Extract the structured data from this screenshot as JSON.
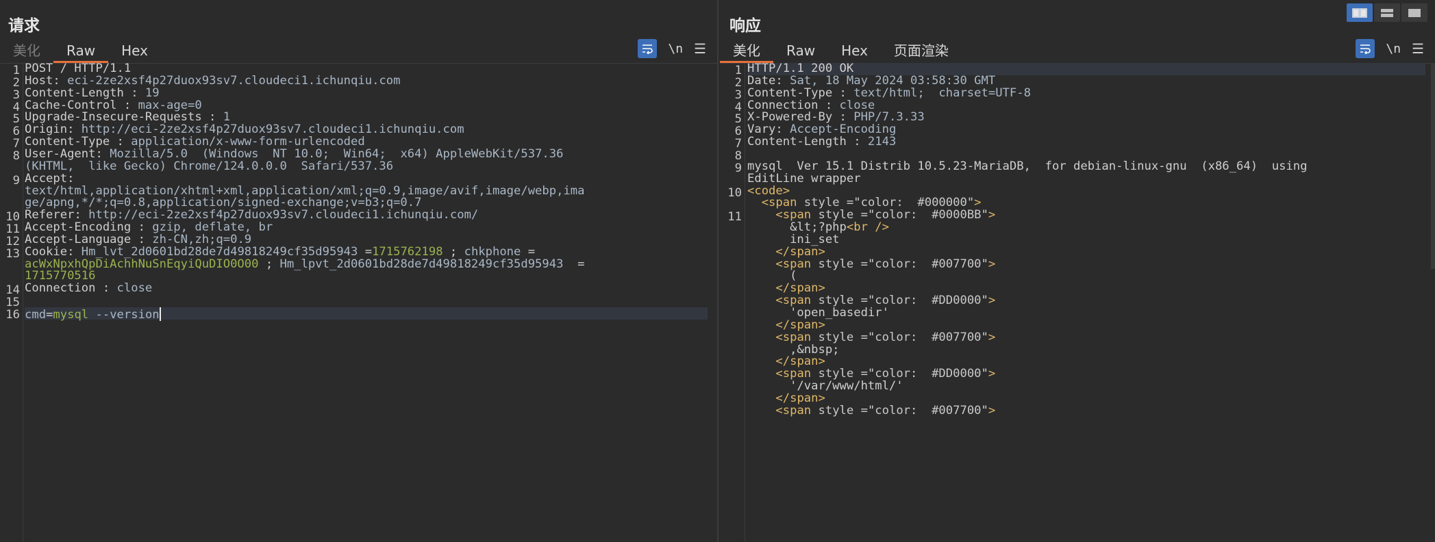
{
  "request": {
    "title": "请求",
    "tabs": [
      {
        "label": "美化",
        "state": "disabled"
      },
      {
        "label": "Raw",
        "state": "active"
      },
      {
        "label": "Hex",
        "state": "normal"
      }
    ],
    "newline_label": "\\n",
    "lines": [
      {
        "n": "1",
        "segs": [
          {
            "t": "POST / HTTP/1.1",
            "c": "k"
          }
        ]
      },
      {
        "n": "2",
        "segs": [
          {
            "t": "Host",
            "c": "k"
          },
          {
            "t": ": ",
            "c": "k"
          },
          {
            "t": "eci-2ze2xsf4p27duox93sv7.cloudeci1.ichunqiu.com",
            "c": "v"
          }
        ]
      },
      {
        "n": "3",
        "segs": [
          {
            "t": "Content-Length",
            "c": "k"
          },
          {
            "t": " : ",
            "c": "k"
          },
          {
            "t": "19",
            "c": "v"
          }
        ]
      },
      {
        "n": "4",
        "segs": [
          {
            "t": "Cache-Control",
            "c": "k"
          },
          {
            "t": " : ",
            "c": "k"
          },
          {
            "t": "max-age=0",
            "c": "v"
          }
        ]
      },
      {
        "n": "5",
        "segs": [
          {
            "t": "Upgrade-Insecure-Requests",
            "c": "k"
          },
          {
            "t": " : ",
            "c": "k"
          },
          {
            "t": "1",
            "c": "v"
          }
        ]
      },
      {
        "n": "6",
        "segs": [
          {
            "t": "Origin",
            "c": "k"
          },
          {
            "t": ": ",
            "c": "k"
          },
          {
            "t": "http://eci-2ze2xsf4p27duox93sv7.cloudeci1.ichunqiu.com",
            "c": "v"
          }
        ]
      },
      {
        "n": "7",
        "segs": [
          {
            "t": "Content-Type",
            "c": "k"
          },
          {
            "t": " : ",
            "c": "k"
          },
          {
            "t": "application/x-www-form-urlencoded",
            "c": "v"
          }
        ]
      },
      {
        "n": "8",
        "segs": [
          {
            "t": "User-Agent",
            "c": "k"
          },
          {
            "t": ": ",
            "c": "k"
          },
          {
            "t": "Mozilla/5.0  (Windows  NT 10.0;  Win64;  x64) AppleWebKit/537.36",
            "c": "v"
          }
        ]
      },
      {
        "n": "",
        "segs": [
          {
            "t": "(KHTML,  like Gecko) Chrome/124.0.0.0  Safari/537.36",
            "c": "v"
          }
        ]
      },
      {
        "n": "9",
        "segs": [
          {
            "t": "Accept",
            "c": "k"
          },
          {
            "t": ":",
            "c": "k"
          }
        ]
      },
      {
        "n": "",
        "segs": [
          {
            "t": "text/html,application/xhtml+xml,application/xml;q=0.9,image/avif,image/webp,ima",
            "c": "v"
          }
        ]
      },
      {
        "n": "",
        "segs": [
          {
            "t": "ge/apng,*/*;q=0.8,application/signed-exchange;v=b3;q=0.7",
            "c": "v"
          }
        ]
      },
      {
        "n": "10",
        "segs": [
          {
            "t": "Referer",
            "c": "k"
          },
          {
            "t": ": ",
            "c": "k"
          },
          {
            "t": "http://eci-2ze2xsf4p27duox93sv7.cloudeci1.ichunqiu.com/",
            "c": "v"
          }
        ]
      },
      {
        "n": "11",
        "segs": [
          {
            "t": "Accept-Encoding",
            "c": "k"
          },
          {
            "t": " : ",
            "c": "k"
          },
          {
            "t": "gzip, deflate, br",
            "c": "v"
          }
        ]
      },
      {
        "n": "12",
        "segs": [
          {
            "t": "Accept-Language",
            "c": "k"
          },
          {
            "t": " : ",
            "c": "k"
          },
          {
            "t": "zh-CN,zh;q=0.9",
            "c": "v"
          }
        ]
      },
      {
        "n": "13",
        "segs": [
          {
            "t": "Cookie",
            "c": "k"
          },
          {
            "t": ": ",
            "c": "k"
          },
          {
            "t": "Hm_lvt_2d0601bd28de7d49818249cf35d95943",
            "c": "v"
          },
          {
            "t": " =",
            "c": "k"
          },
          {
            "t": "1715762198",
            "c": "g"
          },
          {
            "t": " ; ",
            "c": "k"
          },
          {
            "t": "chkphone",
            "c": "v"
          },
          {
            "t": " =",
            "c": "k"
          }
        ]
      },
      {
        "n": "",
        "segs": [
          {
            "t": "acWxNpxhQpDiAchhNuSnEqyiQuDIO0O00",
            "c": "g"
          },
          {
            "t": " ; ",
            "c": "k"
          },
          {
            "t": "Hm_lpvt_2d0601bd28de7d49818249cf35d95943",
            "c": "v"
          },
          {
            "t": "  =",
            "c": "k"
          }
        ]
      },
      {
        "n": "",
        "segs": [
          {
            "t": "1715770516",
            "c": "g"
          }
        ]
      },
      {
        "n": "14",
        "segs": [
          {
            "t": "Connection",
            "c": "k"
          },
          {
            "t": " : ",
            "c": "k"
          },
          {
            "t": "close",
            "c": "v"
          }
        ]
      },
      {
        "n": "15",
        "segs": []
      },
      {
        "n": "16",
        "segs": [
          {
            "t": "cmd",
            "c": "v"
          },
          {
            "t": "=",
            "c": "k"
          },
          {
            "t": "mysql",
            "c": "g"
          },
          {
            "t": " --version",
            "c": "v"
          }
        ],
        "hl": true,
        "cursor": true
      }
    ]
  },
  "response": {
    "title": "响应",
    "tabs": [
      {
        "label": "美化",
        "state": "active"
      },
      {
        "label": "Raw",
        "state": "normal"
      },
      {
        "label": "Hex",
        "state": "normal"
      },
      {
        "label": "页面渲染",
        "state": "normal"
      }
    ],
    "newline_label": "\\n",
    "lines": [
      {
        "n": "1",
        "segs": [
          {
            "t": "HTTP/1.1 200 OK",
            "c": "k"
          }
        ],
        "hl": true
      },
      {
        "n": "2",
        "segs": [
          {
            "t": "Date",
            "c": "k"
          },
          {
            "t": ": ",
            "c": "k"
          },
          {
            "t": "Sat, 18 May 2024 03:58:30 GMT",
            "c": "v"
          }
        ]
      },
      {
        "n": "3",
        "segs": [
          {
            "t": "Content-Type",
            "c": "k"
          },
          {
            "t": " : ",
            "c": "k"
          },
          {
            "t": "text/html;  charset=UTF-8",
            "c": "v"
          }
        ]
      },
      {
        "n": "4",
        "segs": [
          {
            "t": "Connection",
            "c": "k"
          },
          {
            "t": " : ",
            "c": "k"
          },
          {
            "t": "close",
            "c": "v"
          }
        ]
      },
      {
        "n": "5",
        "segs": [
          {
            "t": "X-Powered-By",
            "c": "k"
          },
          {
            "t": " : ",
            "c": "k"
          },
          {
            "t": "PHP/7.3.33",
            "c": "v"
          }
        ]
      },
      {
        "n": "6",
        "segs": [
          {
            "t": "Vary",
            "c": "k"
          },
          {
            "t": ": ",
            "c": "k"
          },
          {
            "t": "Accept-Encoding",
            "c": "v"
          }
        ]
      },
      {
        "n": "7",
        "segs": [
          {
            "t": "Content-Length",
            "c": "k"
          },
          {
            "t": " : ",
            "c": "k"
          },
          {
            "t": "2143",
            "c": "v"
          }
        ]
      },
      {
        "n": "8",
        "segs": []
      },
      {
        "n": "9",
        "segs": [
          {
            "t": "mysql  Ver 15.1 Distrib 10.5.23-MariaDB,  for debian-linux-gnu  (x86_64)  using",
            "c": "k"
          }
        ]
      },
      {
        "n": "",
        "segs": [
          {
            "t": "EditLine wrapper",
            "c": "k"
          }
        ]
      },
      {
        "n": "10",
        "segs": [
          {
            "t": "<code",
            "c": "tag"
          },
          {
            "t": ">",
            "c": "tag"
          }
        ]
      },
      {
        "n": "",
        "segs": [
          {
            "t": "  ",
            "c": "k"
          },
          {
            "t": "<span",
            "c": "tag"
          },
          {
            "t": " style",
            "c": "attr"
          },
          {
            "t": " =\"",
            "c": "k"
          },
          {
            "t": "color:  #000000",
            "c": "str"
          },
          {
            "t": "\"",
            "c": "k"
          },
          {
            "t": ">",
            "c": "tag"
          }
        ]
      },
      {
        "n": "11",
        "segs": [
          {
            "t": "    ",
            "c": "k"
          },
          {
            "t": "<span",
            "c": "tag"
          },
          {
            "t": " style",
            "c": "attr"
          },
          {
            "t": " =\"",
            "c": "k"
          },
          {
            "t": "color:  #0000BB",
            "c": "str"
          },
          {
            "t": "\"",
            "c": "k"
          },
          {
            "t": ">",
            "c": "tag"
          }
        ]
      },
      {
        "n": "",
        "segs": [
          {
            "t": "      &lt;?php",
            "c": "k"
          },
          {
            "t": "<br />",
            "c": "tag"
          }
        ]
      },
      {
        "n": "",
        "segs": [
          {
            "t": "      ini_set",
            "c": "k"
          }
        ]
      },
      {
        "n": "",
        "segs": [
          {
            "t": "    ",
            "c": "k"
          },
          {
            "t": "</span>",
            "c": "tag"
          }
        ]
      },
      {
        "n": "",
        "segs": [
          {
            "t": "    ",
            "c": "k"
          },
          {
            "t": "<span",
            "c": "tag"
          },
          {
            "t": " style",
            "c": "attr"
          },
          {
            "t": " =\"",
            "c": "k"
          },
          {
            "t": "color:  #007700",
            "c": "str"
          },
          {
            "t": "\"",
            "c": "k"
          },
          {
            "t": ">",
            "c": "tag"
          }
        ]
      },
      {
        "n": "",
        "segs": [
          {
            "t": "      (",
            "c": "k"
          }
        ]
      },
      {
        "n": "",
        "segs": [
          {
            "t": "    ",
            "c": "k"
          },
          {
            "t": "</span>",
            "c": "tag"
          }
        ]
      },
      {
        "n": "",
        "segs": [
          {
            "t": "    ",
            "c": "k"
          },
          {
            "t": "<span",
            "c": "tag"
          },
          {
            "t": " style",
            "c": "attr"
          },
          {
            "t": " =\"",
            "c": "k"
          },
          {
            "t": "color:  #DD0000",
            "c": "str"
          },
          {
            "t": "\"",
            "c": "k"
          },
          {
            "t": ">",
            "c": "tag"
          }
        ]
      },
      {
        "n": "",
        "segs": [
          {
            "t": "      'open_basedir'",
            "c": "k"
          }
        ]
      },
      {
        "n": "",
        "segs": [
          {
            "t": "    ",
            "c": "k"
          },
          {
            "t": "</span>",
            "c": "tag"
          }
        ]
      },
      {
        "n": "",
        "segs": [
          {
            "t": "    ",
            "c": "k"
          },
          {
            "t": "<span",
            "c": "tag"
          },
          {
            "t": " style",
            "c": "attr"
          },
          {
            "t": " =\"",
            "c": "k"
          },
          {
            "t": "color:  #007700",
            "c": "str"
          },
          {
            "t": "\"",
            "c": "k"
          },
          {
            "t": ">",
            "c": "tag"
          }
        ]
      },
      {
        "n": "",
        "segs": [
          {
            "t": "      ,&nbsp;",
            "c": "k"
          }
        ]
      },
      {
        "n": "",
        "segs": [
          {
            "t": "    ",
            "c": "k"
          },
          {
            "t": "</span>",
            "c": "tag"
          }
        ]
      },
      {
        "n": "",
        "segs": [
          {
            "t": "    ",
            "c": "k"
          },
          {
            "t": "<span",
            "c": "tag"
          },
          {
            "t": " style",
            "c": "attr"
          },
          {
            "t": " =\"",
            "c": "k"
          },
          {
            "t": "color:  #DD0000",
            "c": "str"
          },
          {
            "t": "\"",
            "c": "k"
          },
          {
            "t": ">",
            "c": "tag"
          }
        ]
      },
      {
        "n": "",
        "segs": [
          {
            "t": "      '/var/www/html/'",
            "c": "k"
          }
        ]
      },
      {
        "n": "",
        "segs": [
          {
            "t": "    ",
            "c": "k"
          },
          {
            "t": "</span>",
            "c": "tag"
          }
        ]
      },
      {
        "n": "",
        "segs": [
          {
            "t": "    ",
            "c": "k"
          },
          {
            "t": "<span",
            "c": "tag"
          },
          {
            "t": " style",
            "c": "attr"
          },
          {
            "t": " =\"",
            "c": "k"
          },
          {
            "t": "color:  #007700",
            "c": "str"
          },
          {
            "t": "\"",
            "c": "k"
          },
          {
            "t": ">",
            "c": "tag"
          }
        ]
      }
    ]
  },
  "colors": {
    "accent": "#e8703a",
    "tool_blue": "#3d6fb8",
    "background": "#2b2b2b",
    "number_green": "#9bb34f"
  },
  "icons": {
    "wrap": "word-wrap-icon",
    "menu": "hamburger-menu-icon",
    "layout": [
      "layout-side-by-side-icon",
      "layout-stacked-icon",
      "layout-single-icon"
    ]
  }
}
